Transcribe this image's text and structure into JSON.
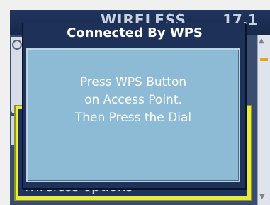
{
  "background": {
    "title": "WIRELESS",
    "clock": "17.1",
    "selected_item": "Wireless options"
  },
  "dialog": {
    "title": "Connected By WPS",
    "message_lines": [
      "Press WPS Button",
      "on Access Point.",
      "Then Press the Dial"
    ]
  },
  "colors": {
    "dialog_bg": "#1e3158",
    "body_bg": "#8dbbd6",
    "highlight": "#e7ec3a",
    "scroll_thumb": "#f0a020"
  },
  "icons": {
    "scroll_up": "triangle-up-icon",
    "scroll_down": "triangle-down-icon"
  }
}
